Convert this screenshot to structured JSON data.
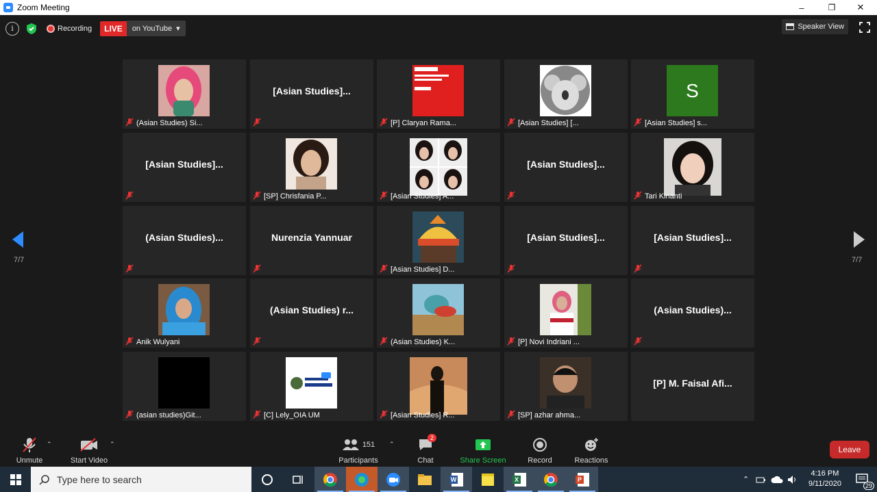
{
  "window": {
    "title": "Zoom Meeting",
    "minimize": "–",
    "restore": "❐",
    "close": "✕"
  },
  "topbar": {
    "info": "i",
    "recording": "Recording",
    "live": "LIVE",
    "live_dest": "on YouTube",
    "speaker_view": "Speaker View"
  },
  "page_left": "7/7",
  "page_right": "7/7",
  "tiles": [
    {
      "label": "(Asian Studies) Si...",
      "name": ""
    },
    {
      "label": "",
      "name": "[Asian Studies]..."
    },
    {
      "label": "[P] Claryan Rama...",
      "name": ""
    },
    {
      "label": "[Asian Studies] [...",
      "name": ""
    },
    {
      "label": "[Asian Studies] s...",
      "name": "",
      "avatar_letter": "S"
    },
    {
      "label": "",
      "name": "[Asian Studies]..."
    },
    {
      "label": "[SP] Chrisfania P...",
      "name": ""
    },
    {
      "label": "[Asian Studies] A...",
      "name": ""
    },
    {
      "label": "",
      "name": "[Asian Studies]..."
    },
    {
      "label": "Tari Kinanti",
      "name": ""
    },
    {
      "label": "",
      "name": "(Asian Studies)..."
    },
    {
      "label": "",
      "name": "Nurenzia Yannuar"
    },
    {
      "label": "[Asian Studies] D...",
      "name": ""
    },
    {
      "label": "",
      "name": "[Asian Studies]..."
    },
    {
      "label": "",
      "name": "[Asian Studies]..."
    },
    {
      "label": "Anik Wulyani",
      "name": ""
    },
    {
      "label": "",
      "name": "(Asian Studies) r..."
    },
    {
      "label": "(Asian Studies) K...",
      "name": ""
    },
    {
      "label": "[P] Novi Indriani ...",
      "name": ""
    },
    {
      "label": "",
      "name": "(Asian Studies)..."
    },
    {
      "label": "(asian studies)Git...",
      "name": ""
    },
    {
      "label": "[C] Lely_OIA UM",
      "name": ""
    },
    {
      "label": "[Asian Studies] R...",
      "name": ""
    },
    {
      "label": "[SP] azhar ahma...",
      "name": ""
    },
    {
      "label": "",
      "name": "[P] M. Faisal Afi..."
    }
  ],
  "toolbar": {
    "unmute": "Unmute",
    "start_video": "Start Video",
    "participants_count": "151",
    "participants": "Participants",
    "chat_badge": "2",
    "chat": "Chat",
    "share_screen": "Share Screen",
    "record": "Record",
    "reactions": "Reactions",
    "leave": "Leave"
  },
  "taskbar": {
    "search_placeholder": "Type here to search",
    "time": "4:16 PM",
    "date": "9/11/2020",
    "notif_count": "29"
  },
  "colors": {
    "accent_blue": "#2D8CFF",
    "live_red": "#e02828",
    "share_green": "#23c552",
    "leave_red": "#c62a2a"
  }
}
